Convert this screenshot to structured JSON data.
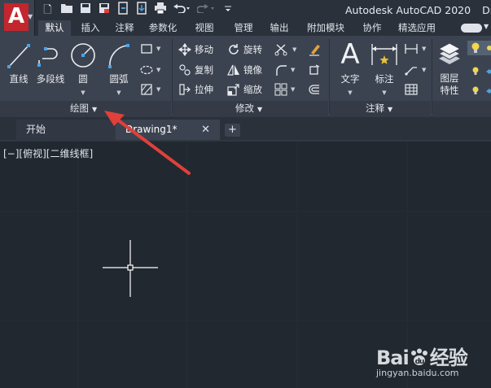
{
  "titlebar": {
    "app_title": "Autodesk AutoCAD 2020",
    "doc_title_partial": "Dra",
    "app_logo_letter": "A",
    "quick_access_icons": [
      "new-icon",
      "open-icon",
      "save-icon",
      "save-as-icon",
      "web-open-icon",
      "web-save-icon",
      "plot-icon",
      "undo-icon",
      "redo-icon",
      "customize-icon"
    ]
  },
  "ribbon_tabs": [
    "默认",
    "插入",
    "注释",
    "参数化",
    "视图",
    "管理",
    "输出",
    "附加模块",
    "协作",
    "精选应用"
  ],
  "active_tab": "默认",
  "panels": {
    "draw": {
      "title": "绘图",
      "line": "直线",
      "polyline": "多段线",
      "circle": "圆",
      "arc": "圆弧"
    },
    "modify": {
      "title": "修改",
      "move": "移动",
      "rotate": "旋转",
      "copy": "复制",
      "mirror": "镜像",
      "stretch": "拉伸",
      "scale": "缩放"
    },
    "annotation": {
      "title": "注释",
      "text": "文字",
      "dimension": "标注",
      "text_glyph": "A"
    },
    "layers": {
      "properties_line1": "图层",
      "properties_line2": "特性"
    }
  },
  "doc_tabs": {
    "start": "开始",
    "drawing": "Drawing1*",
    "close": "✕",
    "add": "+"
  },
  "viewport": {
    "label": "[−][俯视][二维线框]"
  },
  "watermark": {
    "brand": "Bai",
    "brand_suffix": "经验",
    "url": "jingyan.baidu.com"
  },
  "colors": {
    "accent_blue": "#4aa3e8",
    "arrow_red": "#e0403a",
    "logo_red": "#c3262d",
    "ribbon_bg": "#3c4350",
    "canvas_bg": "#212830"
  }
}
